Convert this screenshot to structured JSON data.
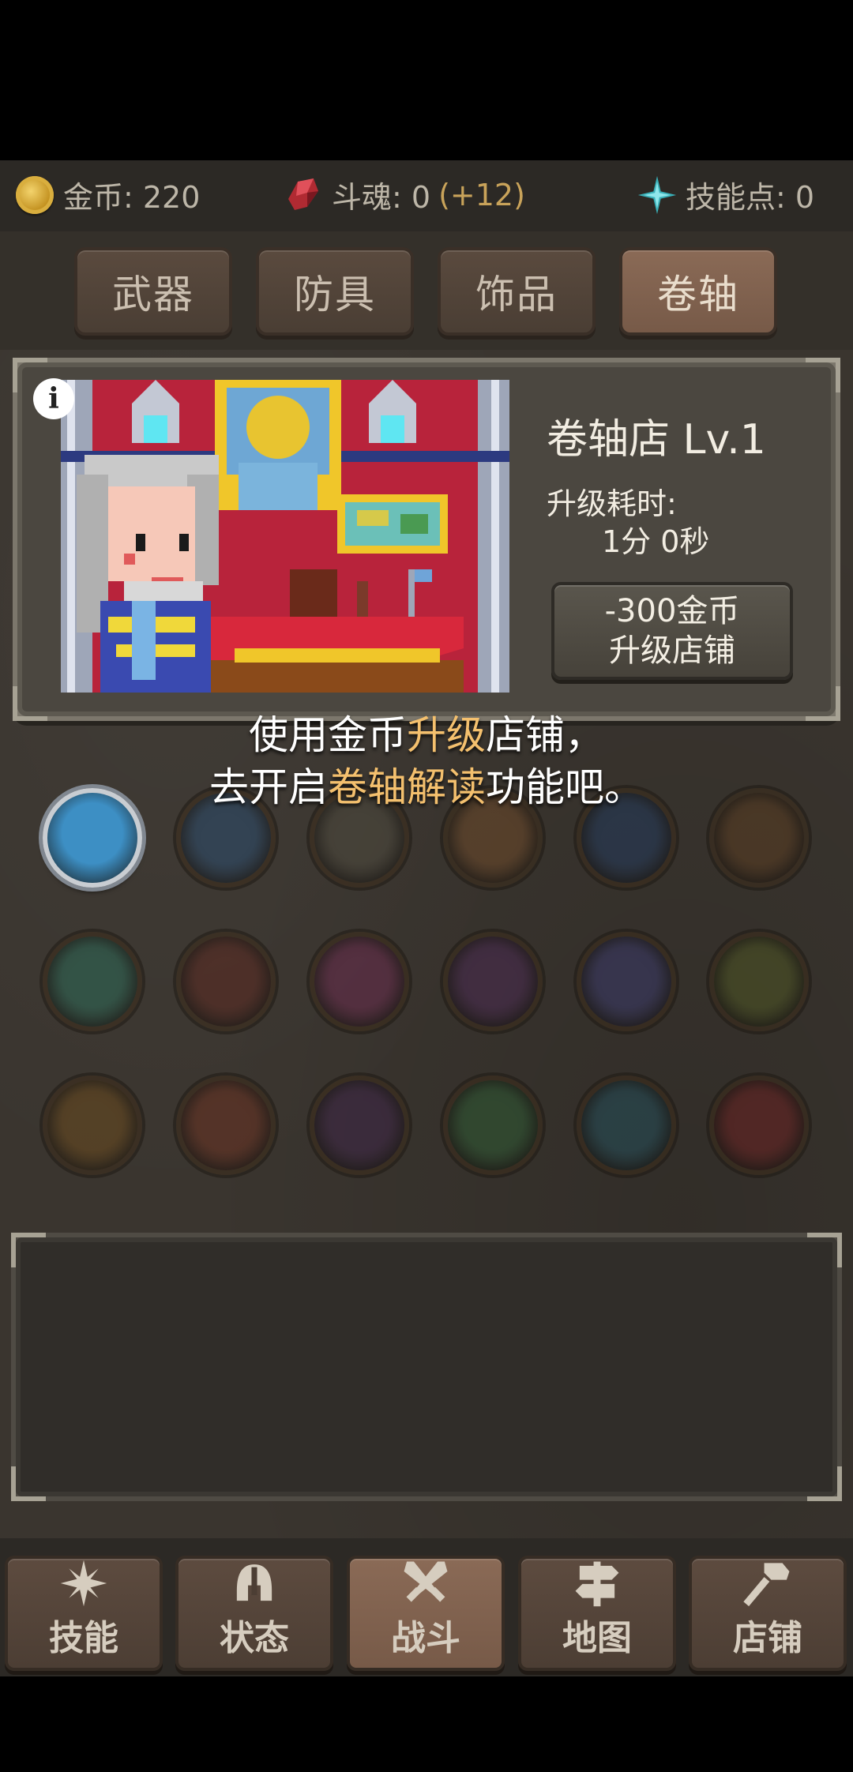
{
  "resources": {
    "gold": "金币: 220",
    "soul": "斗魂: 0",
    "soul_bonus": "(+12)",
    "skill_points": "技能点: 0"
  },
  "shop_tabs": [
    "武器",
    "防具",
    "饰品",
    "卷轴"
  ],
  "active_shop_tab": "卷轴",
  "shop": {
    "title": "卷轴店 Lv.1",
    "time_label": "升级耗时:",
    "time_value": "1分 0秒",
    "upgrade_cost": "-300金币",
    "upgrade_label": "升级店铺",
    "info_glyph": "i"
  },
  "hint": {
    "line1_a": "使用金币",
    "line1_hl": "升级",
    "line1_b": "店铺，",
    "line2_a": "去开启",
    "line2_hl": "卷轴解读",
    "line2_b": "功能吧。"
  },
  "skills": [
    {
      "icon": "ice-crystal-icon",
      "color": "#3d8fc4",
      "unlocked": true
    },
    {
      "icon": "lightning-slash-icon",
      "color": "#2b4c6e",
      "unlocked": false
    },
    {
      "icon": "target-rune-icon",
      "color": "#4e4a3e",
      "unlocked": false
    },
    {
      "icon": "fire-burst-icon",
      "color": "#6e4a2a",
      "unlocked": false
    },
    {
      "icon": "frost-tree-icon",
      "color": "#233a5c",
      "unlocked": false
    },
    {
      "icon": "flame-warrior-icon",
      "color": "#5a3d22",
      "unlocked": false
    },
    {
      "icon": "whirlpool-icon",
      "color": "#2d6a58",
      "unlocked": false
    },
    {
      "icon": "blood-crack-icon",
      "color": "#5c2a22",
      "unlocked": false
    },
    {
      "icon": "pink-flame-icon",
      "color": "#6a2c4e",
      "unlocked": false
    },
    {
      "icon": "demon-mask-icon",
      "color": "#4a2a52",
      "unlocked": false
    },
    {
      "icon": "arcane-burst-icon",
      "color": "#3a3a6a",
      "unlocked": false
    },
    {
      "icon": "poison-sprout-icon",
      "color": "#4e5624",
      "unlocked": false
    },
    {
      "icon": "flame-shield-icon",
      "color": "#6a4a1e",
      "unlocked": false
    },
    {
      "icon": "fire-swirl-icon",
      "color": "#6a3222",
      "unlocked": false
    },
    {
      "icon": "shadow-web-icon",
      "color": "#3e2648",
      "unlocked": false
    },
    {
      "icon": "heal-heart-icon",
      "color": "#2e5a34",
      "unlocked": false
    },
    {
      "icon": "vine-eye-icon",
      "color": "#244e5a",
      "unlocked": false
    },
    {
      "icon": "blood-rage-icon",
      "color": "#6a2222",
      "unlocked": false
    }
  ],
  "nav": [
    {
      "label": "技能",
      "icon": "sparkle-icon"
    },
    {
      "label": "状态",
      "icon": "helmet-icon"
    },
    {
      "label": "战斗",
      "icon": "crossed-swords-icon"
    },
    {
      "label": "地图",
      "icon": "signpost-icon"
    },
    {
      "label": "店铺",
      "icon": "hammer-icon"
    }
  ],
  "active_nav": "战斗",
  "colors": {
    "background": "#3a352f",
    "highlight": "#f4c06e",
    "soul_bonus": "#c9a35a",
    "active_tab": "#8a6a56"
  }
}
